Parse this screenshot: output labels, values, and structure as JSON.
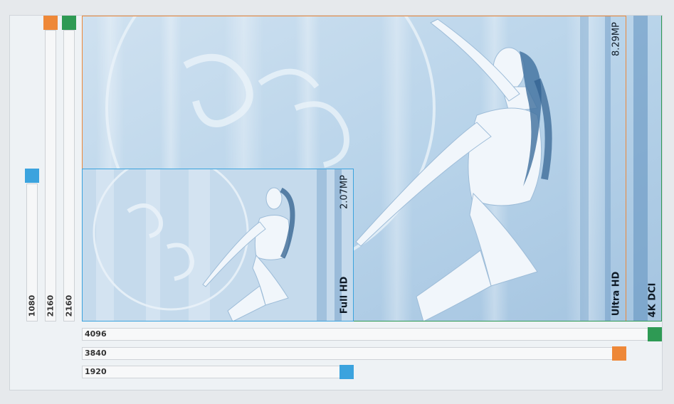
{
  "colors": {
    "full_hd": "#3ba3de",
    "ultra_hd": "#ee8838",
    "k4_dci": "#2e9a54"
  },
  "vertical_bars": [
    {
      "label": "1080",
      "color_key": "full_hd"
    },
    {
      "label": "2160",
      "color_key": "ultra_hd"
    },
    {
      "label": "2160",
      "color_key": "k4_dci"
    }
  ],
  "horizontal_bars": [
    {
      "label": "4096",
      "color_key": "k4_dci"
    },
    {
      "label": "3840",
      "color_key": "ultra_hd"
    },
    {
      "label": "1920",
      "color_key": "full_hd"
    }
  ],
  "frames": {
    "full_hd": {
      "name": "Full HD",
      "megapixels": "2.07MP"
    },
    "ultra_hd": {
      "name": "Ultra HD",
      "megapixels": "8.29MP"
    },
    "k4_dci": {
      "name": "4K DCI"
    }
  }
}
